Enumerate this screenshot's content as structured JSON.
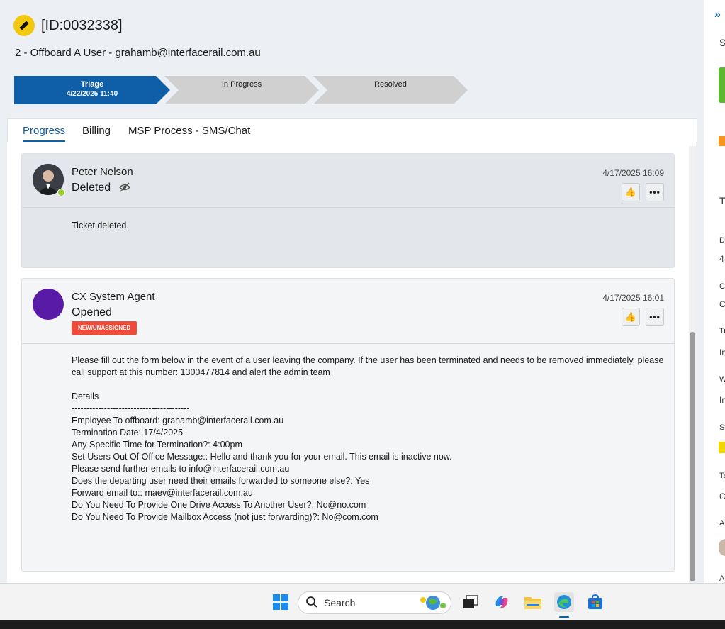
{
  "ticket": {
    "id": "[ID:0032338]",
    "subject": "2 - Offboard A User - grahamb@interfacerail.com.au",
    "icon": "ticket-icon"
  },
  "stages": [
    {
      "name": "Triage",
      "date": "4/22/2025 11:40"
    },
    {
      "name": "In Progress"
    },
    {
      "name": "Resolved"
    }
  ],
  "tabs": [
    "Progress",
    "Billing",
    "MSP Process - SMS/Chat"
  ],
  "entries": [
    {
      "author": "Peter Nelson",
      "action": "Deleted",
      "timestamp": "4/17/2025 16:09",
      "body": [
        "Ticket deleted."
      ]
    },
    {
      "author": "CX System Agent",
      "action": "Opened",
      "badge": "NEW/UNASSIGNED",
      "timestamp": "4/17/2025 16:01",
      "body": [
        "Please fill out the form below in the event of a user leaving the company. If the user has been terminated and needs to be removed immediately, please call support at this number: 1300477814 and alert the admin team",
        "",
        "Details",
        "----------------------------------------",
        "Employee To offboard: grahamb@interfacerail.com.au",
        "Termination Date: 17/4/2025",
        "Any Specific Time for Termination?: 4:00pm",
        "Set Users Out Of Office Message:: Hello and thank you for your email. This email is inactive now.",
        "Please send further emails to info@interfacerail.com.au",
        "Does the departing user need their emails forwarded to someone else?: Yes",
        "Forward email to:: maev@interfacerail.com.au",
        "Do You Need To Provide One Drive Access To Another User?: No@no.com",
        "Do You Need To Provide Mailbox Access (not just forwarding)?: No@com.com"
      ]
    }
  ],
  "side_letters": [
    "S",
    "T",
    "D",
    "4",
    "C",
    "C",
    "Ti",
    "In",
    "W",
    "In",
    "St",
    "Te",
    "C",
    "As",
    "A"
  ],
  "taskbar": {
    "search_placeholder": "Search"
  },
  "colors": {
    "accent": "#0f5ea8",
    "badge": "#f04b3a",
    "ticket_icon": "#f2c811"
  }
}
